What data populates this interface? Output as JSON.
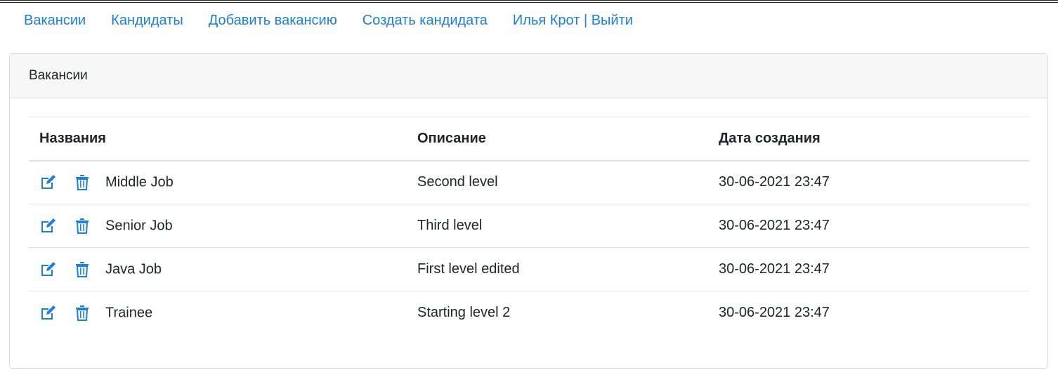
{
  "nav": {
    "items": [
      {
        "label": "Вакансии"
      },
      {
        "label": "Кандидаты"
      },
      {
        "label": "Добавить вакансию"
      },
      {
        "label": "Создать кандидата"
      },
      {
        "label": "Илья Крот | Выйти"
      }
    ]
  },
  "card": {
    "title": "Вакансии"
  },
  "table": {
    "headers": {
      "name": "Названия",
      "description": "Описание",
      "created": "Дата создания"
    },
    "rows": [
      {
        "name": "Middle Job",
        "description": "Second level",
        "created": "30-06-2021 23:47"
      },
      {
        "name": "Senior Job",
        "description": "Third level",
        "created": "30-06-2021 23:47"
      },
      {
        "name": "Java Job",
        "description": "First level edited",
        "created": "30-06-2021 23:47"
      },
      {
        "name": "Trainee",
        "description": "Starting level 2",
        "created": "30-06-2021 23:47"
      }
    ]
  },
  "icons": {
    "edit": "edit-icon",
    "delete": "trash-icon"
  },
  "colors": {
    "link": "#1a7fe6",
    "header_bg": "#f7f7f7"
  }
}
